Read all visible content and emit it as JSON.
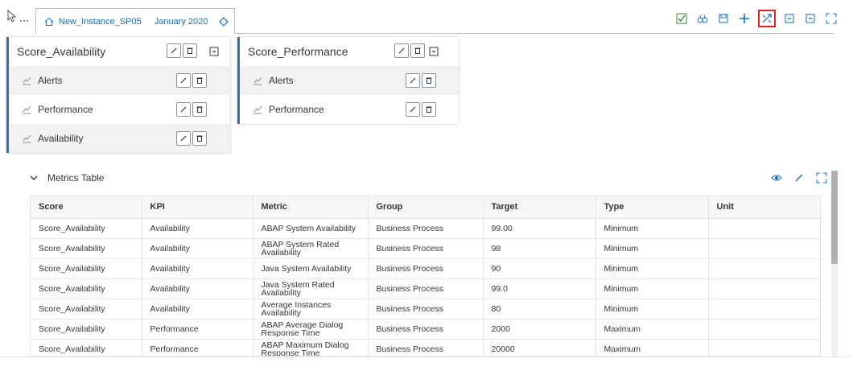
{
  "app": {
    "tab_title": "New_Instance_SP05",
    "tab_date": "January 2020"
  },
  "toolbar": {
    "icons": [
      "check-icon",
      "binoculars-icon",
      "save-icon",
      "add-icon",
      "expand-arrows-icon",
      "collapse-icon",
      "expand-icon",
      "fullscreen-icon"
    ],
    "highlight_color": "#e02020"
  },
  "cards": [
    {
      "title": "Score_Availability",
      "kpis": [
        "Alerts",
        "Performance",
        "Availability"
      ]
    },
    {
      "title": "Score_Performance",
      "kpis": [
        "Alerts",
        "Performance"
      ]
    }
  ],
  "metrics": {
    "title": "Metrics Table",
    "columns": [
      "Score",
      "KPI",
      "Metric",
      "Group",
      "Target",
      "Type",
      "Unit"
    ],
    "rows": [
      [
        "Score_Availability",
        "Availability",
        "ABAP System Availability",
        "Business Process",
        "99.00",
        "Minimum",
        ""
      ],
      [
        "Score_Availability",
        "Availability",
        "ABAP System Rated Availability",
        "Business Process",
        "98",
        "Minimum",
        ""
      ],
      [
        "Score_Availability",
        "Availability",
        "Java System Availability",
        "Business Process",
        "90",
        "Minimum",
        ""
      ],
      [
        "Score_Availability",
        "Availability",
        "Java System Rated Availability",
        "Business Process",
        "99.0",
        "Minimum",
        ""
      ],
      [
        "Score_Availability",
        "Availability",
        "Average Instances Availability",
        "Business Process",
        "80",
        "Minimum",
        ""
      ],
      [
        "Score_Availability",
        "Performance",
        "ABAP Average Dialog Response Time",
        "Business Process",
        "2000",
        "Maximum",
        ""
      ],
      [
        "Score_Availability",
        "Performance",
        "ABAP Maximum Dialog Response Time",
        "Business Process",
        "20000",
        "Maximum",
        ""
      ]
    ]
  },
  "colors": {
    "accent": "#0a6ed1",
    "card_border": "#426b9c"
  }
}
